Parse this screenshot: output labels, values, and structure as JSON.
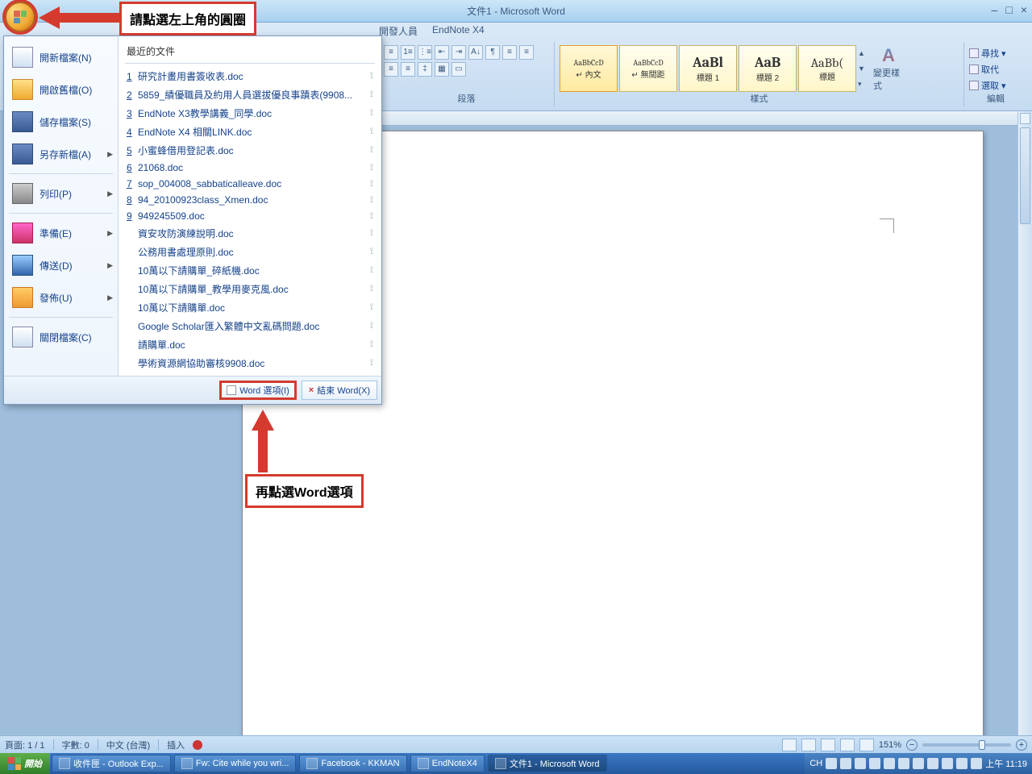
{
  "window": {
    "title": "文件1 - Microsoft Word"
  },
  "ribbon": {
    "tabs": [
      "開發人員",
      "EndNote X4"
    ],
    "group_paragraph": "段落",
    "group_styles": "樣式",
    "group_edit": "編輯",
    "styles": [
      {
        "sample": "AaBbCcD",
        "name": "↵ 內文"
      },
      {
        "sample": "AaBbCcD",
        "name": "↵ 無間距"
      },
      {
        "sample": "AaBl",
        "name": "標題 1"
      },
      {
        "sample": "AaB",
        "name": "標題 2"
      },
      {
        "sample": "AaBb(",
        "name": "標題"
      }
    ],
    "change_style": "變更樣式",
    "edit_find": "尋找 ▾",
    "edit_replace": "取代",
    "edit_select": "選取 ▾"
  },
  "menu": {
    "items": [
      {
        "label": "開新檔案(N)",
        "icon": "ic-new",
        "arrow": false
      },
      {
        "label": "開啟舊檔(O)",
        "icon": "ic-open",
        "arrow": false
      },
      {
        "label": "儲存檔案(S)",
        "icon": "ic-save",
        "arrow": false
      },
      {
        "label": "另存新檔(A)",
        "icon": "ic-saveas",
        "arrow": true
      },
      {
        "label": "列印(P)",
        "icon": "ic-print",
        "arrow": true
      },
      {
        "label": "準備(E)",
        "icon": "ic-prep",
        "arrow": true
      },
      {
        "label": "傳送(D)",
        "icon": "ic-send",
        "arrow": true
      },
      {
        "label": "發佈(U)",
        "icon": "ic-pub",
        "arrow": true
      },
      {
        "label": "關閉檔案(C)",
        "icon": "ic-close",
        "arrow": false
      }
    ],
    "recent_header": "最近的文件",
    "recent": [
      {
        "n": "1",
        "name": "研究計畫用書簽收表.doc"
      },
      {
        "n": "2",
        "name": "5859_績優職員及約用人員選拔優良事蹟表(9908..."
      },
      {
        "n": "3",
        "name": "EndNote X3教學講義_同學.doc"
      },
      {
        "n": "4",
        "name": "EndNote X4 相關LINK.doc"
      },
      {
        "n": "5",
        "name": "小蜜蜂借用登記表.doc"
      },
      {
        "n": "6",
        "name": "21068.doc"
      },
      {
        "n": "7",
        "name": "sop_004008_sabbaticalleave.doc"
      },
      {
        "n": "8",
        "name": "94_20100923class_Xmen.doc"
      },
      {
        "n": "9",
        "name": "949245509.doc"
      },
      {
        "n": "",
        "name": "資安攻防演練說明.doc"
      },
      {
        "n": "",
        "name": "公務用書處理原則.doc"
      },
      {
        "n": "",
        "name": "10萬以下請購單_碎紙機.doc"
      },
      {
        "n": "",
        "name": "10萬以下請購單_教學用麥克風.doc"
      },
      {
        "n": "",
        "name": "10萬以下請購單.doc"
      },
      {
        "n": "",
        "name": "Google Scholar匯入繁體中文亂碼問題.doc"
      },
      {
        "n": "",
        "name": "請購單.doc"
      },
      {
        "n": "",
        "name": "學術資源網協助審核9908.doc"
      }
    ],
    "word_options": "Word 選項(I)",
    "exit_word": "結束 Word(X)"
  },
  "status": {
    "page": "頁面: 1 / 1",
    "words": "字數: 0",
    "lang": "中文 (台灣)",
    "mode": "插入",
    "zoom": "151%"
  },
  "taskbar": {
    "start": "開始",
    "items": [
      "收件匣 - Outlook Exp...",
      "Fw: Cite while you wri...",
      "Facebook - KKMAN",
      "EndNoteX4",
      "文件1 - Microsoft Word"
    ],
    "ime": "CH",
    "clock": "上午 11:19"
  },
  "annotations": {
    "top": "請點選左上角的圓圈",
    "bottom": "再點選Word選項"
  }
}
